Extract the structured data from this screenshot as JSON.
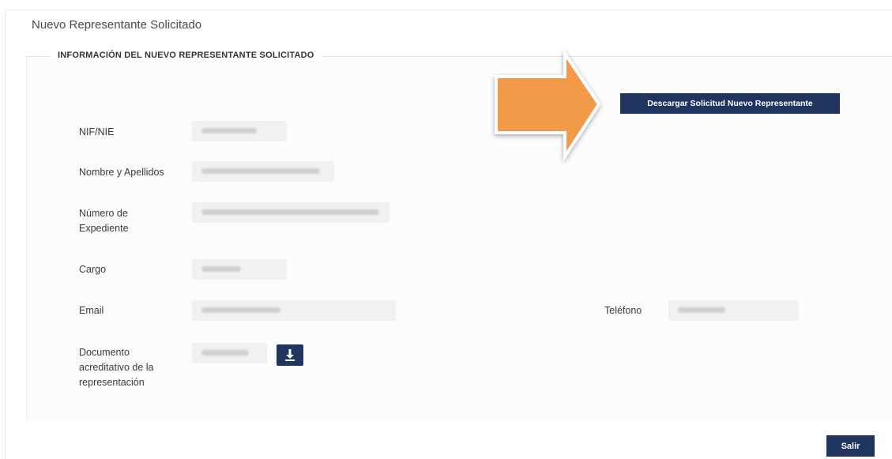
{
  "page": {
    "title": "Nuevo Representante Solicitado"
  },
  "section": {
    "legend": "INFORMACIÓN DEL NUEVO REPRESENTANTE SOLICITADO"
  },
  "actions": {
    "download_request_label": "Descargar Solicitud Nuevo Representante",
    "exit_label": "Salir"
  },
  "fields": {
    "nif_label": "NIF/NIE",
    "name_label": "Nombre y Apellidos",
    "file_number_label_line1": "Número de",
    "file_number_label_line2": "Expediente",
    "position_label": "Cargo",
    "email_label": "Email",
    "phone_label": "Teléfono",
    "document_label_line1": "Documento",
    "document_label_line2": "acreditativo de la",
    "document_label_line3": "representación"
  },
  "icons": {
    "download_icon": "download-icon",
    "callout_arrow": "arrow-right-icon"
  },
  "colors": {
    "primary_button": "#1f3560",
    "callout_arrow": "#f39a4a"
  }
}
